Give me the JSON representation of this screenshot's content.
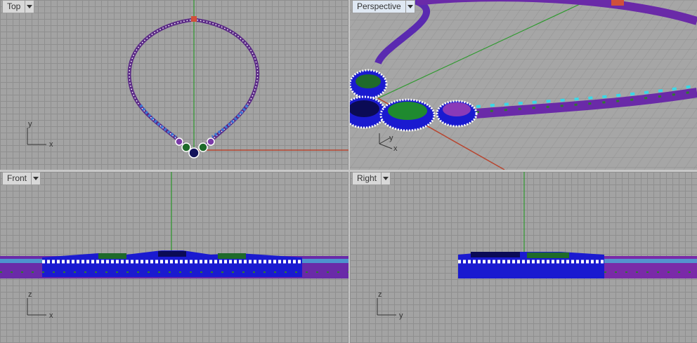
{
  "viewports": {
    "top": {
      "title": "Top",
      "axis_labels": [
        "y",
        "x"
      ]
    },
    "perspective": {
      "title": "Perspective",
      "axis_labels": [
        "y",
        "x"
      ]
    },
    "front": {
      "title": "Front",
      "axis_labels": [
        "z",
        "x"
      ]
    },
    "right": {
      "title": "Right",
      "axis_labels": [
        "z",
        "y"
      ]
    }
  },
  "colors": {
    "background": "#a3a3a3",
    "x_axis": "#b8452f",
    "y_axis": "#2f9a2f",
    "gem_blue": "#1a1ad0",
    "gem_purple": "#7a3aa8",
    "gem_green": "#1f6a2a",
    "gem_cyan": "#3ad8e8",
    "diamond_white": "#ffffff",
    "marker_red": "#d0503a"
  },
  "icons": [
    "dropdown-arrow-icon",
    "world-axes-icon"
  ]
}
